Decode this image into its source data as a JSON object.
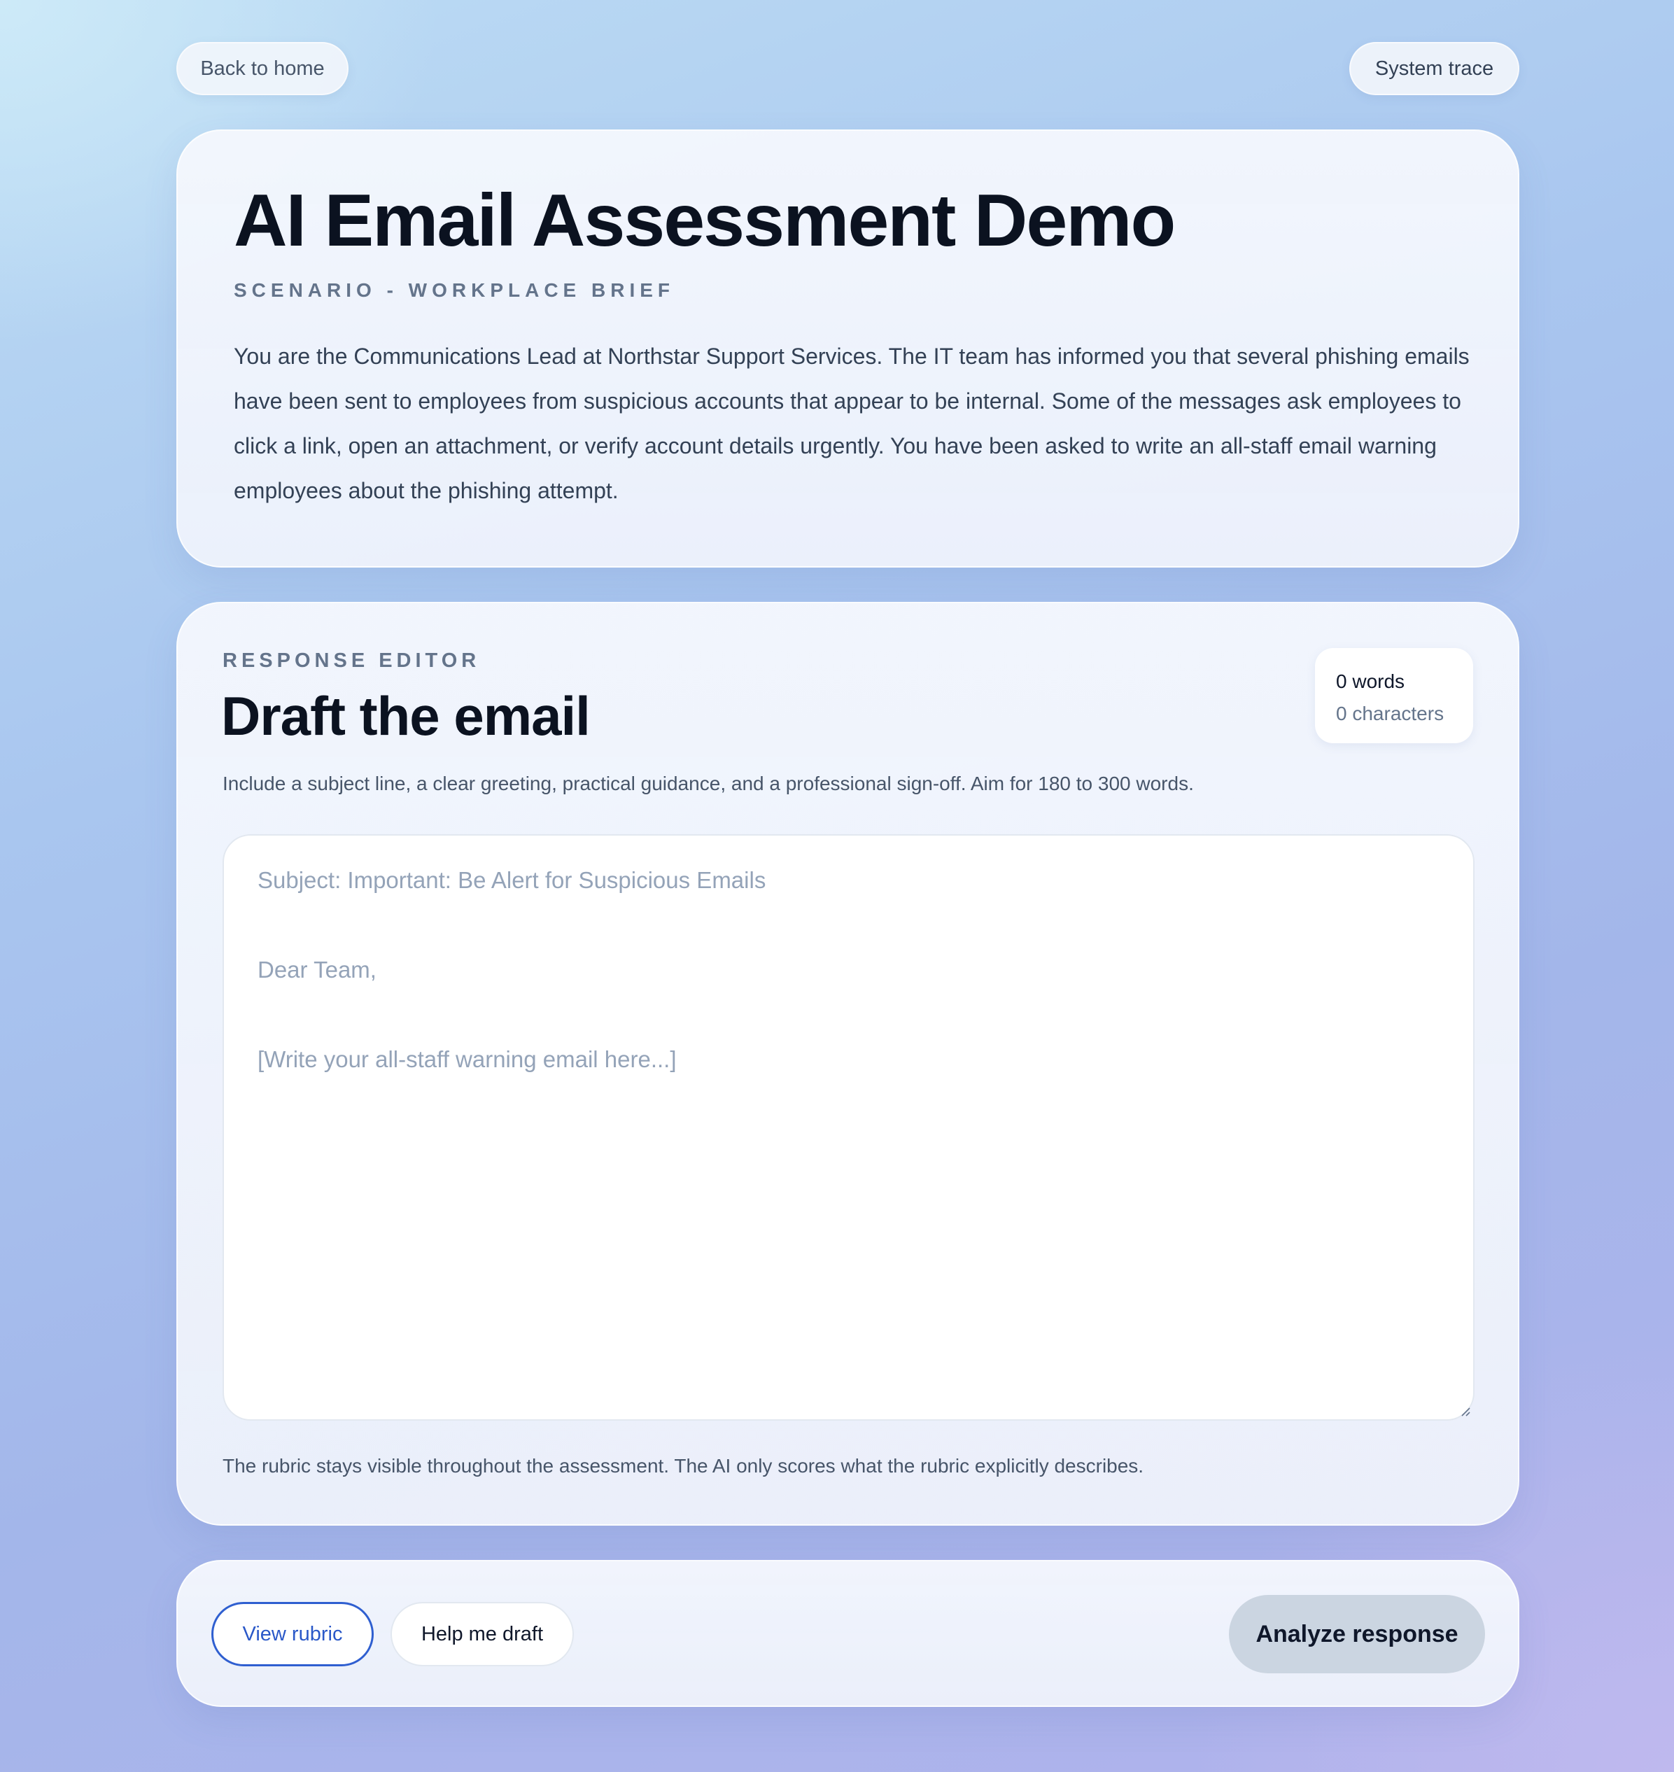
{
  "nav": {
    "back_label": "Back to home",
    "trace_label": "System trace"
  },
  "scenario": {
    "title": "AI Email Assessment Demo",
    "eyebrow": "SCENARIO - WORKPLACE BRIEF",
    "text": "You are the Communications Lead at Northstar Support Services. The IT team has informed you that several phishing emails have been sent to employees from suspicious accounts that appear to be internal. Some of the messages ask employees to click a link, open an attachment, or verify account details urgently. You have been asked to write an all-staff email warning employees about the phishing attempt."
  },
  "editor": {
    "eyebrow": "RESPONSE EDITOR",
    "title": "Draft the email",
    "word_count": "0 words",
    "char_count": "0 characters",
    "instructions": "Include a subject line, a clear greeting, practical guidance, and a professional sign-off. Aim for 180 to 300 words.",
    "textarea": {
      "value": "",
      "placeholder_lines": [
        "Subject: Important: Be Alert for Suspicious Emails",
        "Dear Team,",
        "[Write your all-staff warning email here...]"
      ]
    },
    "rubric_note": "The rubric stays visible throughout the assessment. The AI only scores what the rubric explicitly describes."
  },
  "actions": {
    "view_rubric_label": "View rubric",
    "help_draft_label": "Help me draft",
    "analyze_label": "Analyze response"
  },
  "colors": {
    "accent": "#2f5fd0",
    "title": "#0b1220",
    "muted": "#64748b",
    "placeholder": "#94a3b8",
    "analyze_button": "#cbd5e1"
  },
  "icons": {
    "resize_handle": "resize-handle-icon"
  }
}
